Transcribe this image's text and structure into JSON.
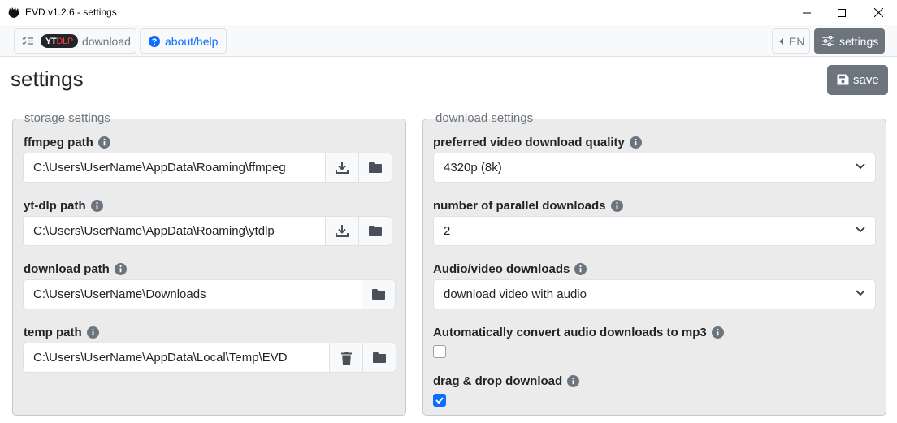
{
  "window": {
    "title": "EVD v1.2.6 - settings"
  },
  "toolbar": {
    "download_logo_yt": "YT",
    "download_logo_dlp": "DLP",
    "download_label": "download",
    "about_label": "about/help",
    "language_label": "EN",
    "settings_label": "settings"
  },
  "page": {
    "title": "settings",
    "save_label": "save"
  },
  "storage": {
    "legend": "storage settings",
    "ffmpeg": {
      "label": "ffmpeg path",
      "value": "C:\\Users\\UserName\\AppData\\Roaming\\ffmpeg"
    },
    "ytdlp": {
      "label": "yt-dlp path",
      "value": "C:\\Users\\UserName\\AppData\\Roaming\\ytdlp"
    },
    "download": {
      "label": "download path",
      "value": "C:\\Users\\UserName\\Downloads"
    },
    "temp": {
      "label": "temp path",
      "value": "C:\\Users\\UserName\\AppData\\Local\\Temp\\EVD"
    }
  },
  "download_settings": {
    "legend": "download settings",
    "quality": {
      "label": "preferred video download quality",
      "value": "4320p (8k)"
    },
    "parallel": {
      "label": "number of parallel downloads",
      "value": "2"
    },
    "av": {
      "label": "Audio/video downloads",
      "value": "download video with audio"
    },
    "mp3": {
      "label": "Automatically convert audio downloads to mp3",
      "checked": false
    },
    "dragdrop": {
      "label": "drag & drop download",
      "checked": true
    }
  },
  "colors": {
    "primary": "#0d6efd",
    "secondary": "#6c757d",
    "panel_bg": "#ebebeb"
  }
}
